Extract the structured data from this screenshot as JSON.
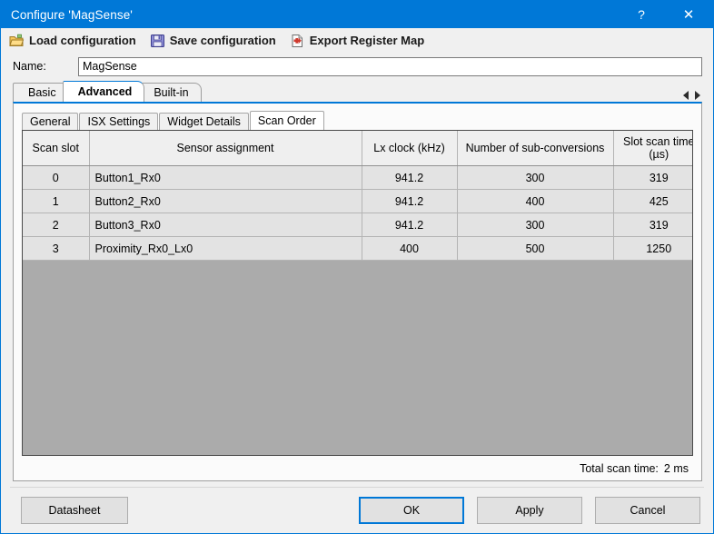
{
  "window": {
    "title": "Configure 'MagSense'",
    "accent_color": "#0078d7",
    "help_glyph": "?",
    "close_glyph": "✕"
  },
  "toolbar": {
    "items": [
      {
        "label": "Load configuration",
        "icon": "open-folder-icon"
      },
      {
        "label": "Save configuration",
        "icon": "floppy-disk-icon"
      },
      {
        "label": "Export Register Map",
        "icon": "export-document-icon"
      }
    ]
  },
  "name_field": {
    "label": "Name:",
    "value": "MagSense",
    "placeholder": ""
  },
  "outer_tabs": {
    "items": [
      {
        "label": "Basic",
        "active": false
      },
      {
        "label": "Advanced",
        "active": true
      },
      {
        "label": "Built-in",
        "active": false
      }
    ],
    "scroll_left_glyph": "◁",
    "scroll_right_glyph": "▷"
  },
  "inner_tabs": {
    "items": [
      {
        "label": "General",
        "active": false
      },
      {
        "label": "ISX Settings",
        "active": false
      },
      {
        "label": "Widget Details",
        "active": false
      },
      {
        "label": "Scan Order",
        "active": true
      }
    ]
  },
  "scan_order_table": {
    "columns": [
      "Scan slot",
      "Sensor assignment",
      "Lx clock (kHz)",
      "Number of sub-conversions",
      "Slot scan time\n(µs)"
    ],
    "column_headers_display": {
      "slot": "Scan slot",
      "sensor": "Sensor assignment",
      "lx_clock": "Lx clock (kHz)",
      "subconversions": "Number of sub-conversions",
      "slot_scan_time_line1": "Slot scan time",
      "slot_scan_time_line2": "(µs)"
    },
    "rows": [
      {
        "slot": "0",
        "sensor": "Button1_Rx0",
        "lx_clock": "941.2",
        "subconversions": "300",
        "slot_scan_time": "319"
      },
      {
        "slot": "1",
        "sensor": "Button2_Rx0",
        "lx_clock": "941.2",
        "subconversions": "400",
        "slot_scan_time": "425"
      },
      {
        "slot": "2",
        "sensor": "Button3_Rx0",
        "lx_clock": "941.2",
        "subconversions": "300",
        "slot_scan_time": "319"
      },
      {
        "slot": "3",
        "sensor": "Proximity_Rx0_Lx0",
        "lx_clock": "400",
        "subconversions": "500",
        "slot_scan_time": "1250"
      }
    ]
  },
  "total": {
    "label": "Total scan time:",
    "value": "2 ms"
  },
  "buttons": {
    "datasheet": "Datasheet",
    "ok": "OK",
    "apply": "Apply",
    "cancel": "Cancel"
  }
}
